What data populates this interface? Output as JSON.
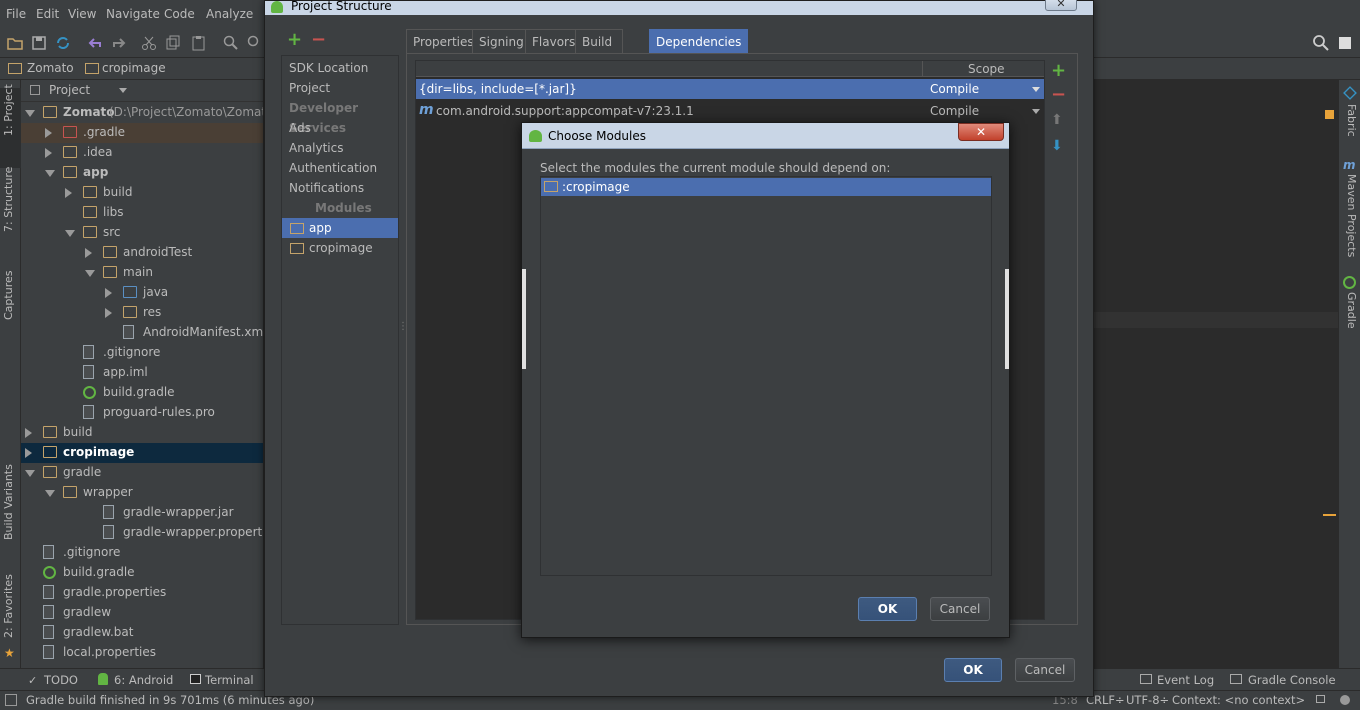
{
  "menubar": {
    "items": [
      "File",
      "Edit",
      "View",
      "Navigate",
      "Code",
      "Analyze"
    ]
  },
  "navbar": {
    "crumbs": [
      "Zomato",
      "cropimage"
    ]
  },
  "left_stripe": {
    "tabs": [
      "1: Project",
      "7: Structure",
      "Captures",
      "Build Variants",
      "2: Favorites"
    ]
  },
  "right_stripe": {
    "tabs": [
      "Fabric",
      "Maven Projects",
      "Gradle"
    ]
  },
  "project_panel": {
    "view_select": "Project",
    "tree": [
      {
        "label": "Zomato",
        "suffix": " (D:\\Project\\Zomato\\Zomato)",
        "bold": true
      },
      {
        "label": ".gradle"
      },
      {
        "label": ".idea"
      },
      {
        "label": "app",
        "bold": true
      },
      {
        "label": "build"
      },
      {
        "label": "libs"
      },
      {
        "label": "src"
      },
      {
        "label": "androidTest"
      },
      {
        "label": "main"
      },
      {
        "label": "java"
      },
      {
        "label": "res"
      },
      {
        "label": "AndroidManifest.xml"
      },
      {
        "label": ".gitignore"
      },
      {
        "label": "app.iml"
      },
      {
        "label": "build.gradle"
      },
      {
        "label": "proguard-rules.pro"
      },
      {
        "label": "build"
      },
      {
        "label": "cropimage",
        "bold": true
      },
      {
        "label": "gradle"
      },
      {
        "label": "wrapper"
      },
      {
        "label": "gradle-wrapper.jar"
      },
      {
        "label": "gradle-wrapper.properties"
      },
      {
        "label": ".gitignore"
      },
      {
        "label": "build.gradle"
      },
      {
        "label": "gradle.properties"
      },
      {
        "label": "gradlew"
      },
      {
        "label": "gradlew.bat"
      },
      {
        "label": "local.properties"
      }
    ]
  },
  "bottom_bar": {
    "tabs_left": [
      "TODO",
      "6: Android",
      "Terminal"
    ],
    "tabs_right": [
      "Event Log",
      "Gradle Console"
    ]
  },
  "status_bar": {
    "message": "Gradle build finished in 9s 701ms (6 minutes ago)",
    "position": "15:8",
    "line_sep": "CRLF÷",
    "encoding": "UTF-8÷",
    "context": "Context: <no context>"
  },
  "project_structure": {
    "title": "Project Structure",
    "categories": [
      {
        "label": "SDK Location"
      },
      {
        "label": "Project"
      },
      {
        "label": "Developer Services",
        "header": true
      },
      {
        "label": "Ads"
      },
      {
        "label": "Analytics"
      },
      {
        "label": "Authentication"
      },
      {
        "label": "Notifications"
      },
      {
        "label": "Modules",
        "header": true
      },
      {
        "label": "app",
        "selected": true
      },
      {
        "label": "cropimage"
      }
    ],
    "tabs": [
      "Properties",
      "Signing",
      "Flavors",
      "Build Types",
      "Dependencies"
    ],
    "selected_tab": "Dependencies",
    "table": {
      "scope_header": "Scope",
      "rows": [
        {
          "name": "{dir=libs, include=[*.jar]}",
          "scope": "Compile",
          "selected": true
        },
        {
          "name": "com.android.support:appcompat-v7:23.1.1",
          "scope": "Compile",
          "selected": false
        }
      ]
    },
    "ok": "OK",
    "cancel": "Cancel"
  },
  "choose_modules": {
    "title": "Choose Modules",
    "prompt": "Select the modules the current module should depend on:",
    "modules": [
      ":cropimage"
    ],
    "ok": "OK",
    "cancel": "Cancel"
  },
  "colors": {
    "selection": "#4b6eaf",
    "panel": "#3c3f41",
    "editor": "#2b2b2b",
    "add_green": "#62b543",
    "remove_red": "#c75450"
  }
}
